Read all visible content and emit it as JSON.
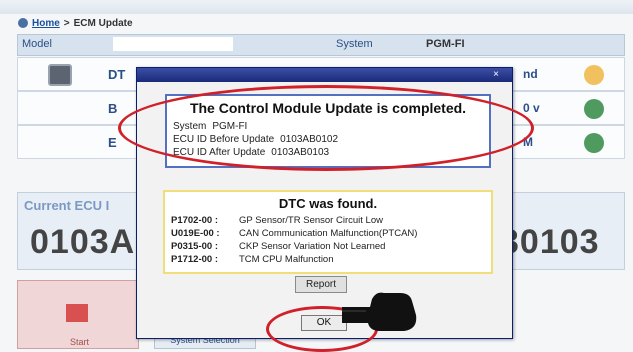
{
  "breadcrumb": {
    "home": "Home",
    "separator": ">",
    "current": "ECM Update"
  },
  "info": {
    "model_label": "Model",
    "system_label": "System",
    "system_value": "PGM-FI"
  },
  "rows": [
    {
      "label": "DT",
      "value": "nd",
      "status_color": "#f2c15f"
    },
    {
      "label": "B",
      "value": "0 v",
      "status_color": "#4f9a5f"
    },
    {
      "label": "E",
      "value": "M",
      "status_color": "#4f9a5f"
    }
  ],
  "current_ecu": {
    "title": "Current ECU I",
    "left_value": "0103A",
    "right_value": "30103"
  },
  "start": {
    "label": "Start"
  },
  "system_selection": {
    "label": "System Selection"
  },
  "dialog": {
    "update_title": "The Control Module Update is completed.",
    "system_label": "System",
    "system_value": "PGM-FI",
    "before_label": "ECU ID Before Update",
    "before_value": "0103AB0102",
    "after_label": "ECU ID After Update",
    "after_value": "0103AB0103",
    "dtc_title": "DTC was found.",
    "dtc": [
      {
        "code": "P1702-00 :",
        "desc": "GP Sensor/TR Sensor Circuit Low"
      },
      {
        "code": "U019E-00 :",
        "desc": "CAN Communication Malfunction(PTCAN)"
      },
      {
        "code": "P0315-00 :",
        "desc": "CKP Sensor Variation Not Learned"
      },
      {
        "code": "P1712-00 :",
        "desc": "TCM CPU Malfunction"
      }
    ],
    "report_label": "Report",
    "ok_label": "OK",
    "close_symbol": "×"
  },
  "colors": {
    "annotation": "#d0202a",
    "dialog_title_bar": "#1a2a7a"
  }
}
